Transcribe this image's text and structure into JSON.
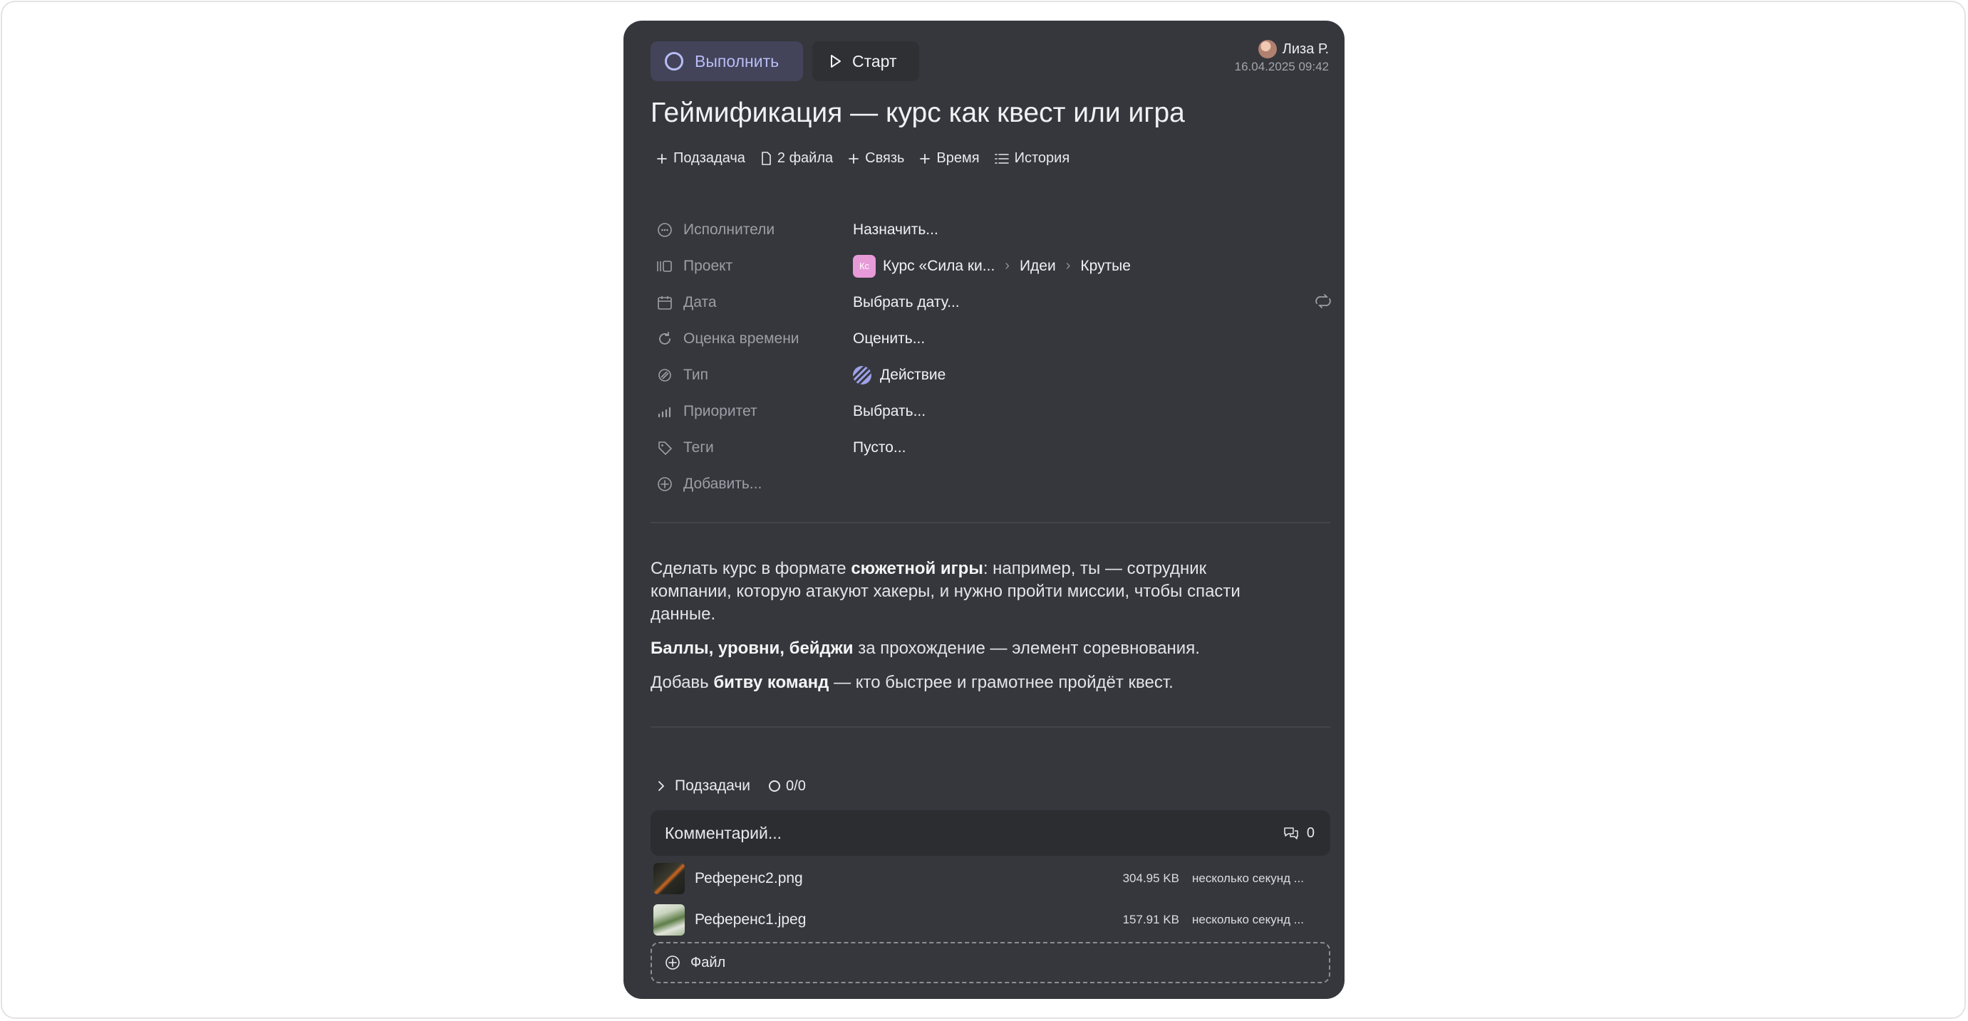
{
  "header": {
    "complete_label": "Выполнить",
    "start_label": "Старт",
    "user_name": "Лиза Р.",
    "timestamp": "16.04.2025 09:42"
  },
  "task": {
    "title": "Геймификация — курс как квест или игра"
  },
  "actions": [
    {
      "label": "Подзадача",
      "icon": "plus-icon"
    },
    {
      "label": "2 файла",
      "icon": "file-icon"
    },
    {
      "label": "Связь",
      "icon": "plus-icon"
    },
    {
      "label": "Время",
      "icon": "plus-icon"
    },
    {
      "label": "История",
      "icon": "list-icon"
    }
  ],
  "properties": {
    "assignees": {
      "label": "Исполнители",
      "value": "Назначить...",
      "icon": "users-icon"
    },
    "project": {
      "label": "Проект",
      "badge": "Кс",
      "badge_color": "#e79ad8",
      "value": "Курс «Сила ки...",
      "crumb1": "Идеи",
      "crumb2": "Крутые",
      "icon": "project-icon"
    },
    "date": {
      "label": "Дата",
      "value": "Выбрать дату...",
      "icon": "calendar-icon"
    },
    "estimate": {
      "label": "Оценка времени",
      "value": "Оценить...",
      "icon": "refresh-icon"
    },
    "type": {
      "label": "Тип",
      "value": "Действие",
      "icon": "type-icon"
    },
    "priority": {
      "label": "Приоритет",
      "value": "Выбрать...",
      "icon": "priority-bars-icon"
    },
    "tags": {
      "label": "Теги",
      "value": "Пусто...",
      "icon": "tag-icon"
    },
    "add": {
      "label": "Добавить...",
      "icon": "add-circle-icon"
    }
  },
  "description": {
    "p1_before": "Сделать курс в формате ",
    "p1_bold": "сюжетной игры",
    "p1_after": ": например, ты — сотрудник компании, которую атакуют хакеры, и нужно пройти миссии, чтобы спасти данные.",
    "p2_bold": "Баллы, уровни, бейджи",
    "p2_after": " за прохождение — элемент соревнования.",
    "p3_before": "Добавь ",
    "p3_bold": "битву команд",
    "p3_after": " — кто быстрее и грамотнее пройдёт квест."
  },
  "subtasks": {
    "label": "Подзадачи",
    "count": "0/0"
  },
  "comment": {
    "placeholder": "Комментарий...",
    "count": "0"
  },
  "files": [
    {
      "name": "Референс2.png",
      "size": "304.95 KB",
      "time": "несколько секунд ..."
    },
    {
      "name": "Референс1.jpeg",
      "size": "157.91 KB",
      "time": "несколько секунд ..."
    }
  ],
  "add_file_label": "Файл",
  "colors": {
    "card_bg": "#35373c",
    "accent": "#b9bdf4",
    "page_bg": "#ffffff"
  }
}
